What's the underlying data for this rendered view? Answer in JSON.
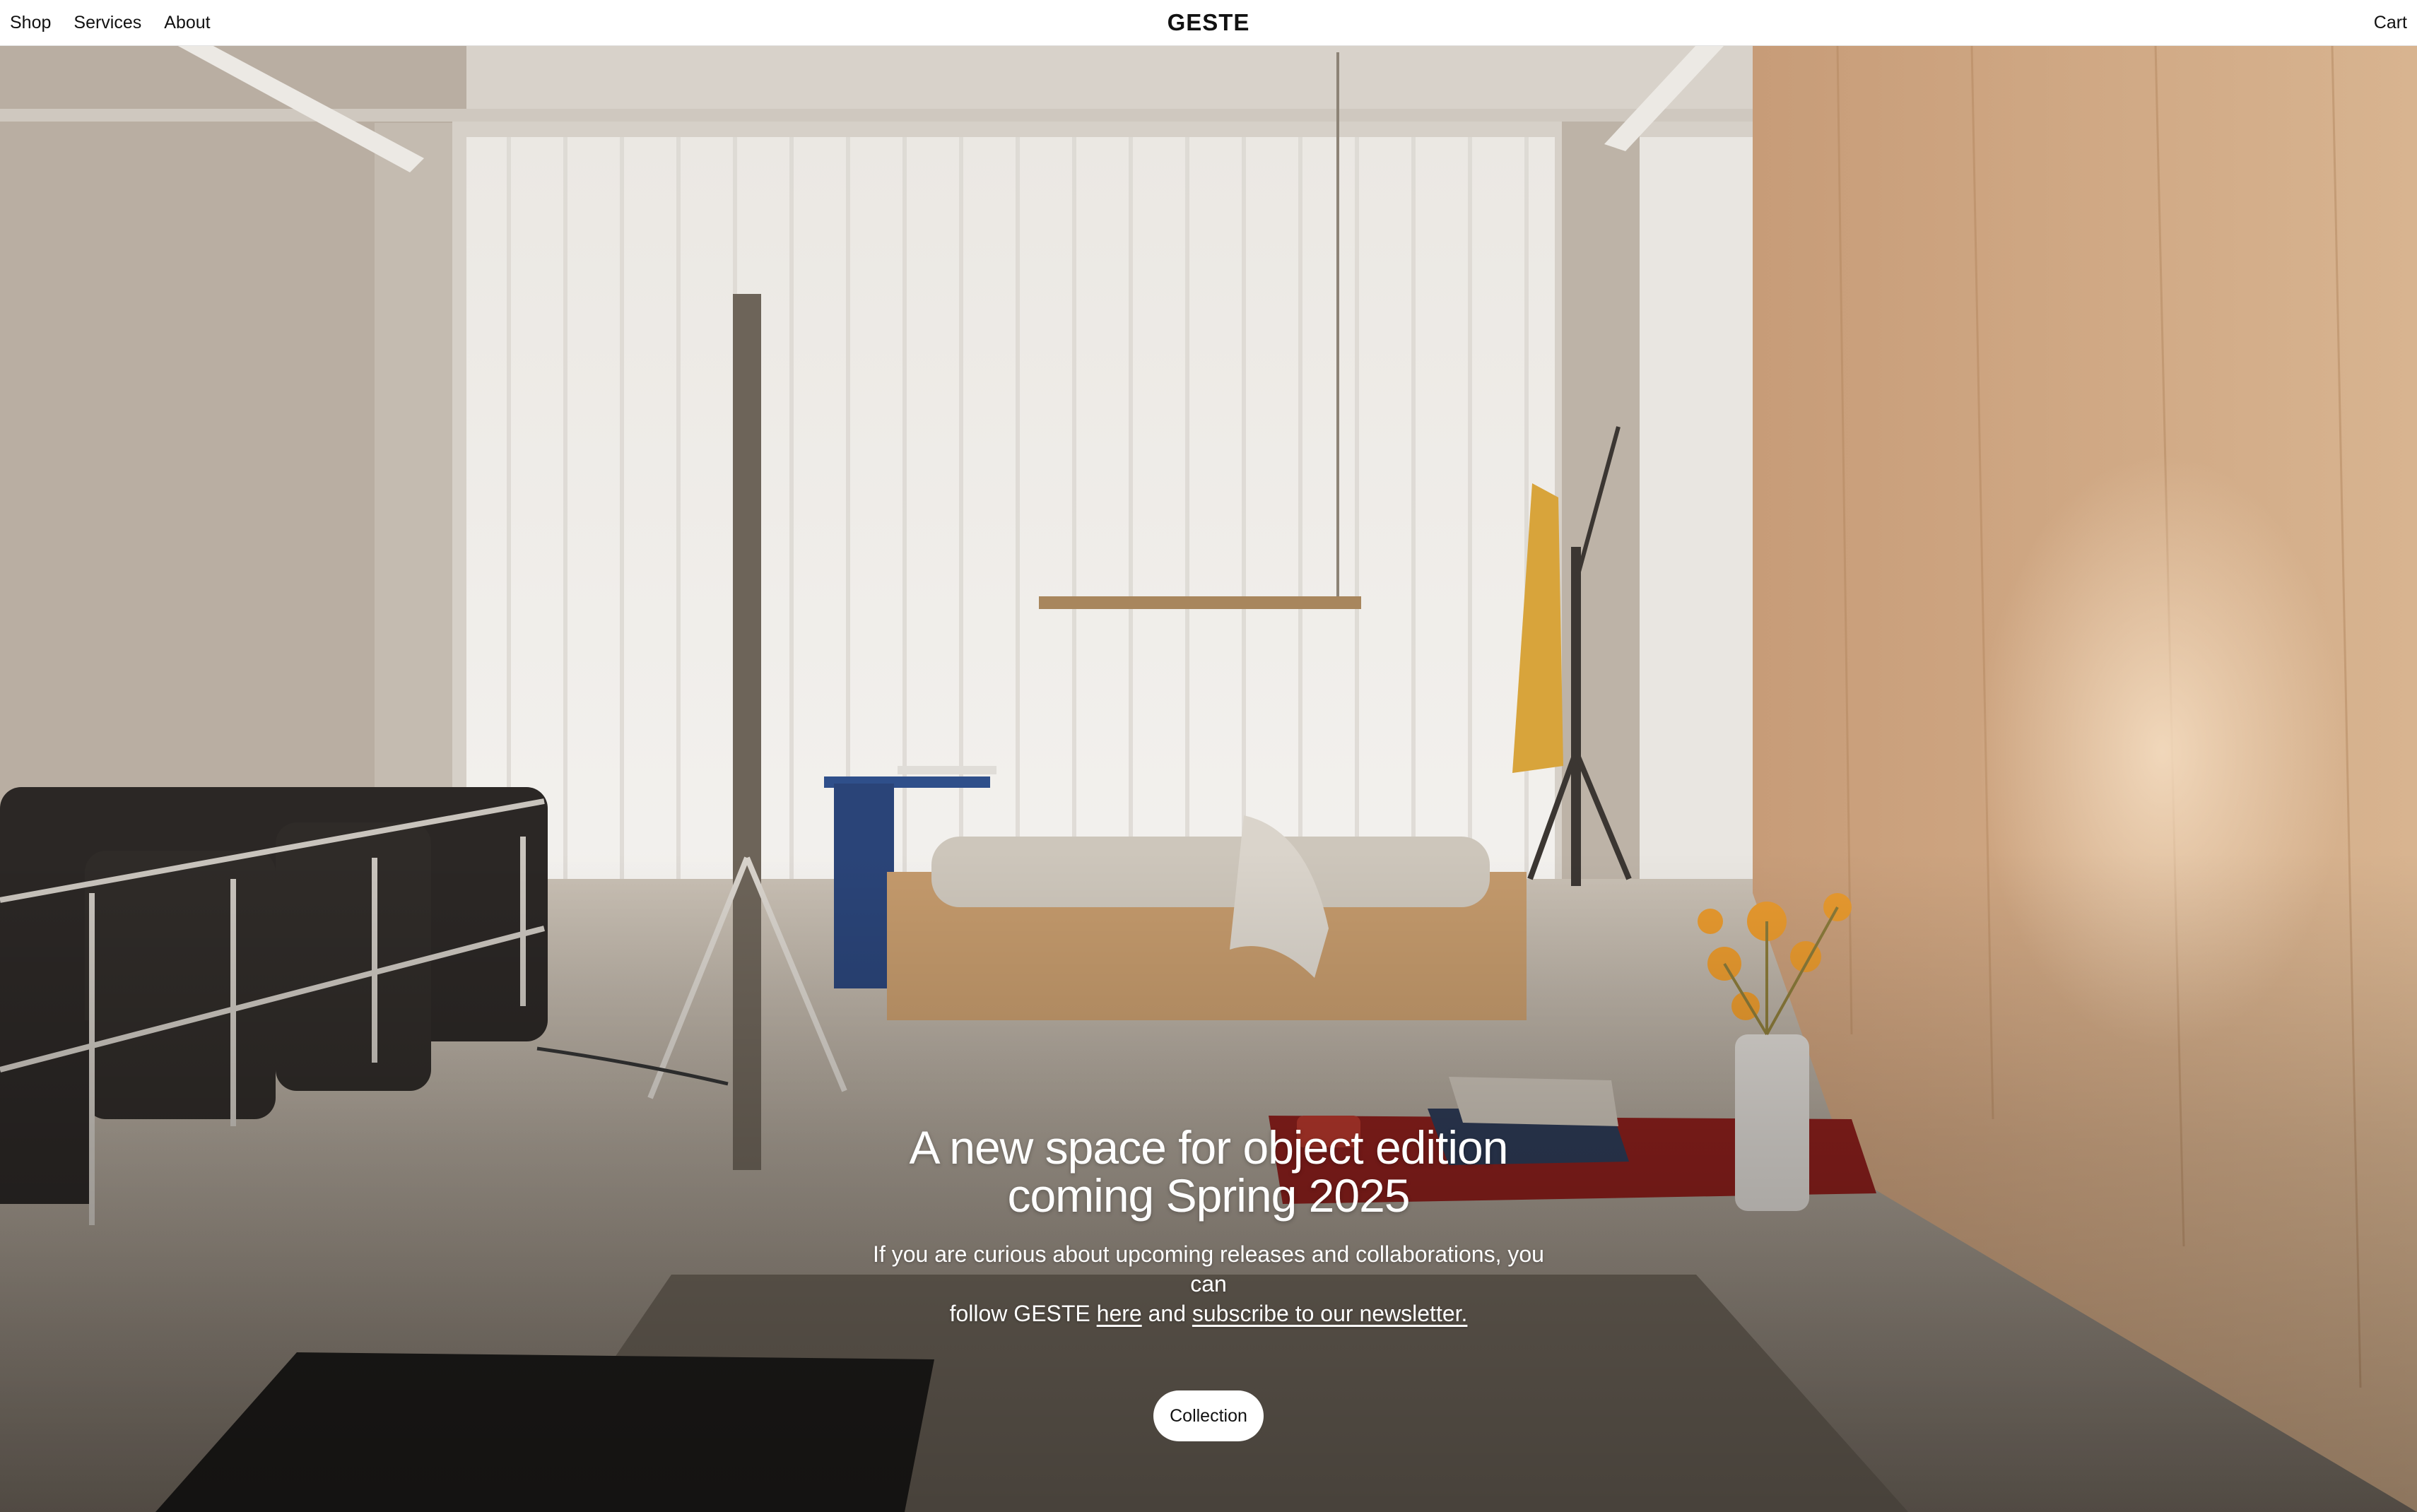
{
  "nav": {
    "left_links": [
      {
        "label": "Shop"
      },
      {
        "label": "Services"
      },
      {
        "label": "About"
      }
    ],
    "brand": "GESTE",
    "cart_label": "Cart"
  },
  "hero": {
    "headline_line1": "A new space for object edition",
    "headline_line2": "coming Spring 2025",
    "sub_line1": "If you are curious about upcoming releases and collaborations, you can",
    "sub_pre": "follow GESTE ",
    "link_here": "here",
    "sub_mid": " and ",
    "link_newsletter": "subscribe to our newsletter.",
    "cta_label": "Collection"
  },
  "colors": {
    "wall_wood": "#c9a07a",
    "concrete": "#b7ada1",
    "sofa": "#2b2725",
    "rug": "#6e655a",
    "red_table": "#8a1f1c",
    "blue_table": "#2f4f8a"
  }
}
